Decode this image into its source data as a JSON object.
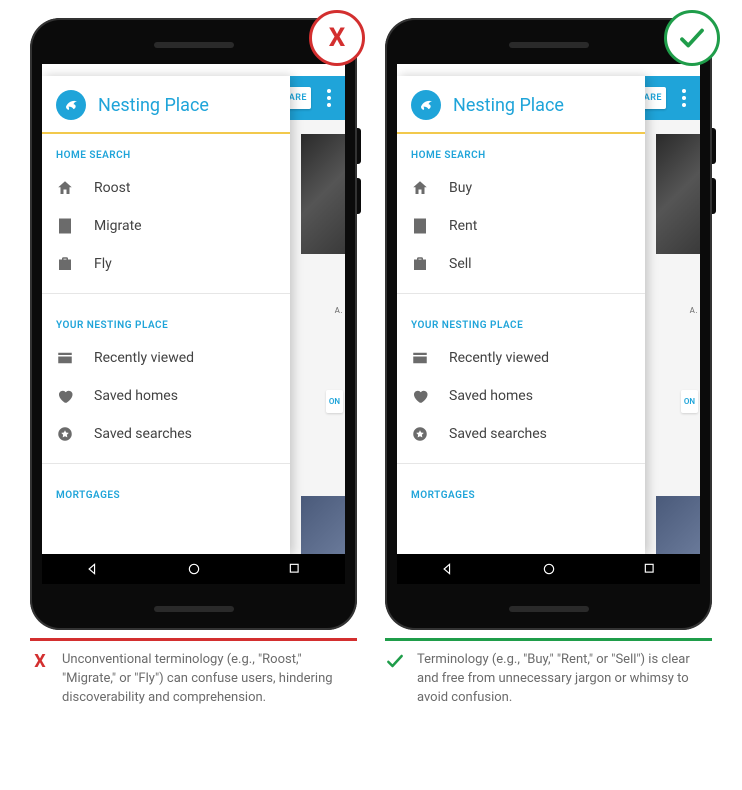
{
  "app": {
    "title": "Nesting Place",
    "overflow_share": "ARE"
  },
  "sections": {
    "home_search": "HOME SEARCH",
    "your_place": "YOUR NESTING PLACE",
    "mortgages": "MORTGAGES"
  },
  "left": {
    "badge": "X",
    "nav_items": [
      {
        "label": "Roost",
        "icon": "home"
      },
      {
        "label": "Migrate",
        "icon": "building"
      },
      {
        "label": "Fly",
        "icon": "briefcase"
      }
    ],
    "caption_icon": "X",
    "caption": "Unconventional terminology (e.g., \"Roost,\" \"Migrate,\" or \"Fly\") can confuse users, hindering discoverability and comprehension."
  },
  "right": {
    "nav_items": [
      {
        "label": "Buy",
        "icon": "home"
      },
      {
        "label": "Rent",
        "icon": "building"
      },
      {
        "label": "Sell",
        "icon": "briefcase"
      }
    ],
    "caption": "Terminology (e.g., \"Buy,\" \"Rent,\" or \"Sell\") is clear and free from unnecessary jargon or whimsy to avoid confusion."
  },
  "saved": [
    {
      "label": "Recently viewed",
      "icon": "card"
    },
    {
      "label": "Saved homes",
      "icon": "heart"
    },
    {
      "label": "Saved searches",
      "icon": "star"
    }
  ],
  "underlay": {
    "text_a": "A.",
    "btn": "ON"
  }
}
